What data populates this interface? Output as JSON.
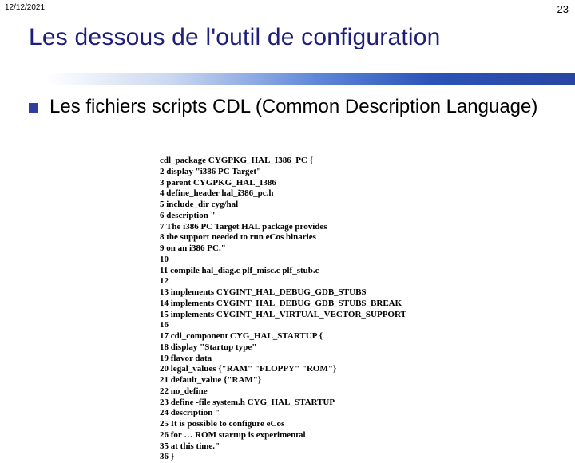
{
  "meta": {
    "date": "12/12/2021",
    "page_number": "23"
  },
  "title": "Les dessous de l'outil de configuration",
  "bullets": [
    {
      "text": "Les fichiers scripts CDL (Common Description Language)"
    }
  ],
  "code": {
    "lines": [
      "cdl_package CYGPKG_HAL_I386_PC {",
      "2 display \"i386 PC Target\"",
      "3 parent CYGPKG_HAL_I386",
      "4 define_header hal_i386_pc.h",
      "5 include_dir cyg/hal",
      "6 description \"",
      "7 The i386 PC Target HAL package provides",
      "8 the support needed to run eCos binaries",
      "9 on an i386 PC.\"",
      "10",
      "11 compile hal_diag.c plf_misc.c plf_stub.c",
      "12",
      "13 implements CYGINT_HAL_DEBUG_GDB_STUBS",
      "14 implements CYGINT_HAL_DEBUG_GDB_STUBS_BREAK",
      "15 implements CYGINT_HAL_VIRTUAL_VECTOR_SUPPORT",
      "16",
      "17 cdl_component CYG_HAL_STARTUP {",
      "18 display \"Startup type\"",
      "19 flavor data",
      "20 legal_values {\"RAM\" \"FLOPPY\" \"ROM\"}",
      "21 default_value {\"RAM\"}",
      "22 no_define",
      "23 define -file system.h CYG_HAL_STARTUP",
      "24 description \"",
      "25 It is possible to configure eCos",
      "26 for … ROM startup is experimental",
      "35 at this time.\"",
      "36 }"
    ]
  }
}
